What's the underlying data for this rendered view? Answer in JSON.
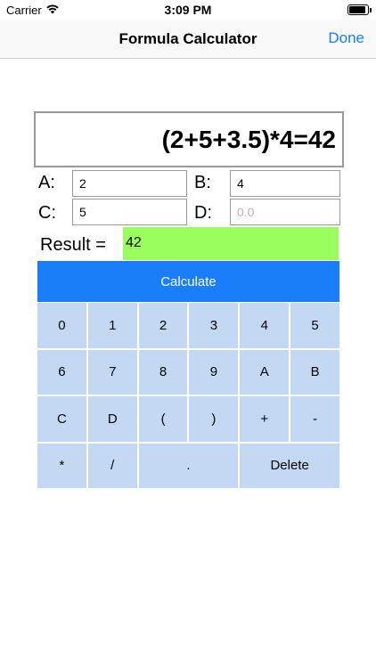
{
  "status": {
    "carrier": "Carrier",
    "time": "3:09 PM"
  },
  "nav": {
    "title": "Formula Calculator",
    "done_label": "Done"
  },
  "formula": "(2+5+3.5)*4=42",
  "variables": {
    "a": {
      "label": "A:",
      "value": "2",
      "placeholder": ""
    },
    "b": {
      "label": "B:",
      "value": "4",
      "placeholder": ""
    },
    "c": {
      "label": "C:",
      "value": "5",
      "placeholder": ""
    },
    "d": {
      "label": "D:",
      "value": "",
      "placeholder": "0.0"
    }
  },
  "result": {
    "label": "Result =",
    "value": "42"
  },
  "calculate_label": "Calculate",
  "keys": [
    "0",
    "1",
    "2",
    "3",
    "4",
    "5",
    "6",
    "7",
    "8",
    "9",
    "A",
    "B",
    "C",
    "D",
    "(",
    ")",
    "+",
    "-",
    "*",
    "/",
    ".",
    "Delete"
  ],
  "colors": {
    "accent": "#1a7efb",
    "key_bg": "#c3d8f3",
    "result_bg": "#9aff5e",
    "link": "#1c7cf4"
  }
}
